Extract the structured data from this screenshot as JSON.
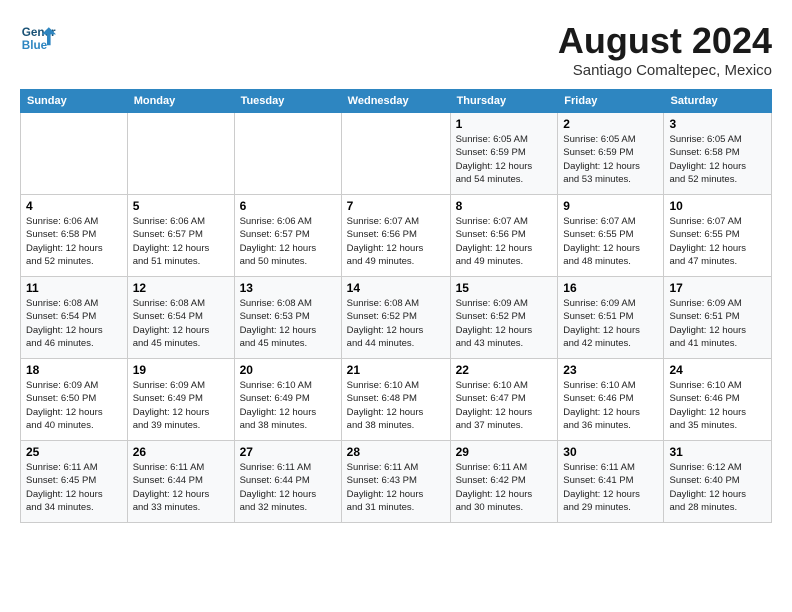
{
  "header": {
    "logo_line1": "General",
    "logo_line2": "Blue",
    "month_title": "August 2024",
    "subtitle": "Santiago Comaltepec, Mexico"
  },
  "weekdays": [
    "Sunday",
    "Monday",
    "Tuesday",
    "Wednesday",
    "Thursday",
    "Friday",
    "Saturday"
  ],
  "weeks": [
    [
      {
        "day": "",
        "info": ""
      },
      {
        "day": "",
        "info": ""
      },
      {
        "day": "",
        "info": ""
      },
      {
        "day": "",
        "info": ""
      },
      {
        "day": "1",
        "info": "Sunrise: 6:05 AM\nSunset: 6:59 PM\nDaylight: 12 hours\nand 54 minutes."
      },
      {
        "day": "2",
        "info": "Sunrise: 6:05 AM\nSunset: 6:59 PM\nDaylight: 12 hours\nand 53 minutes."
      },
      {
        "day": "3",
        "info": "Sunrise: 6:05 AM\nSunset: 6:58 PM\nDaylight: 12 hours\nand 52 minutes."
      }
    ],
    [
      {
        "day": "4",
        "info": "Sunrise: 6:06 AM\nSunset: 6:58 PM\nDaylight: 12 hours\nand 52 minutes."
      },
      {
        "day": "5",
        "info": "Sunrise: 6:06 AM\nSunset: 6:57 PM\nDaylight: 12 hours\nand 51 minutes."
      },
      {
        "day": "6",
        "info": "Sunrise: 6:06 AM\nSunset: 6:57 PM\nDaylight: 12 hours\nand 50 minutes."
      },
      {
        "day": "7",
        "info": "Sunrise: 6:07 AM\nSunset: 6:56 PM\nDaylight: 12 hours\nand 49 minutes."
      },
      {
        "day": "8",
        "info": "Sunrise: 6:07 AM\nSunset: 6:56 PM\nDaylight: 12 hours\nand 49 minutes."
      },
      {
        "day": "9",
        "info": "Sunrise: 6:07 AM\nSunset: 6:55 PM\nDaylight: 12 hours\nand 48 minutes."
      },
      {
        "day": "10",
        "info": "Sunrise: 6:07 AM\nSunset: 6:55 PM\nDaylight: 12 hours\nand 47 minutes."
      }
    ],
    [
      {
        "day": "11",
        "info": "Sunrise: 6:08 AM\nSunset: 6:54 PM\nDaylight: 12 hours\nand 46 minutes."
      },
      {
        "day": "12",
        "info": "Sunrise: 6:08 AM\nSunset: 6:54 PM\nDaylight: 12 hours\nand 45 minutes."
      },
      {
        "day": "13",
        "info": "Sunrise: 6:08 AM\nSunset: 6:53 PM\nDaylight: 12 hours\nand 45 minutes."
      },
      {
        "day": "14",
        "info": "Sunrise: 6:08 AM\nSunset: 6:52 PM\nDaylight: 12 hours\nand 44 minutes."
      },
      {
        "day": "15",
        "info": "Sunrise: 6:09 AM\nSunset: 6:52 PM\nDaylight: 12 hours\nand 43 minutes."
      },
      {
        "day": "16",
        "info": "Sunrise: 6:09 AM\nSunset: 6:51 PM\nDaylight: 12 hours\nand 42 minutes."
      },
      {
        "day": "17",
        "info": "Sunrise: 6:09 AM\nSunset: 6:51 PM\nDaylight: 12 hours\nand 41 minutes."
      }
    ],
    [
      {
        "day": "18",
        "info": "Sunrise: 6:09 AM\nSunset: 6:50 PM\nDaylight: 12 hours\nand 40 minutes."
      },
      {
        "day": "19",
        "info": "Sunrise: 6:09 AM\nSunset: 6:49 PM\nDaylight: 12 hours\nand 39 minutes."
      },
      {
        "day": "20",
        "info": "Sunrise: 6:10 AM\nSunset: 6:49 PM\nDaylight: 12 hours\nand 38 minutes."
      },
      {
        "day": "21",
        "info": "Sunrise: 6:10 AM\nSunset: 6:48 PM\nDaylight: 12 hours\nand 38 minutes."
      },
      {
        "day": "22",
        "info": "Sunrise: 6:10 AM\nSunset: 6:47 PM\nDaylight: 12 hours\nand 37 minutes."
      },
      {
        "day": "23",
        "info": "Sunrise: 6:10 AM\nSunset: 6:46 PM\nDaylight: 12 hours\nand 36 minutes."
      },
      {
        "day": "24",
        "info": "Sunrise: 6:10 AM\nSunset: 6:46 PM\nDaylight: 12 hours\nand 35 minutes."
      }
    ],
    [
      {
        "day": "25",
        "info": "Sunrise: 6:11 AM\nSunset: 6:45 PM\nDaylight: 12 hours\nand 34 minutes."
      },
      {
        "day": "26",
        "info": "Sunrise: 6:11 AM\nSunset: 6:44 PM\nDaylight: 12 hours\nand 33 minutes."
      },
      {
        "day": "27",
        "info": "Sunrise: 6:11 AM\nSunset: 6:44 PM\nDaylight: 12 hours\nand 32 minutes."
      },
      {
        "day": "28",
        "info": "Sunrise: 6:11 AM\nSunset: 6:43 PM\nDaylight: 12 hours\nand 31 minutes."
      },
      {
        "day": "29",
        "info": "Sunrise: 6:11 AM\nSunset: 6:42 PM\nDaylight: 12 hours\nand 30 minutes."
      },
      {
        "day": "30",
        "info": "Sunrise: 6:11 AM\nSunset: 6:41 PM\nDaylight: 12 hours\nand 29 minutes."
      },
      {
        "day": "31",
        "info": "Sunrise: 6:12 AM\nSunset: 6:40 PM\nDaylight: 12 hours\nand 28 minutes."
      }
    ]
  ]
}
